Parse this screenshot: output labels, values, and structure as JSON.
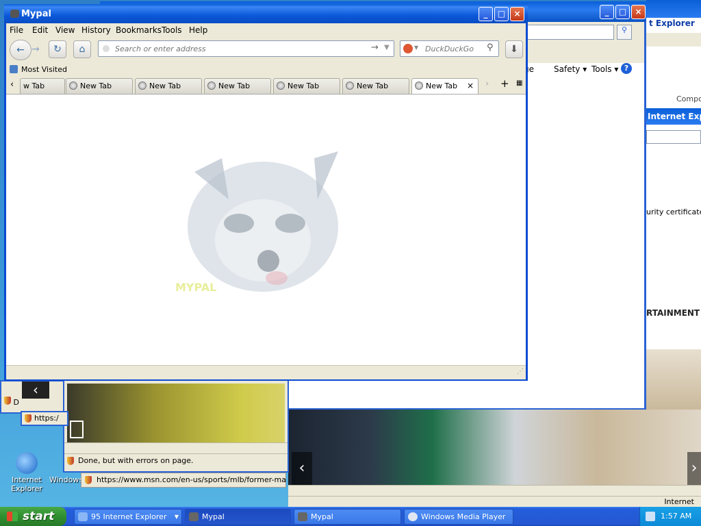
{
  "desktop": {
    "icons": [
      {
        "label": "Internet Explorer",
        "icon": "internet-explorer-icon"
      },
      {
        "label": "Windows Media Player",
        "icon": "media-player-icon"
      }
    ]
  },
  "ie_back": {
    "title": "t Explorer",
    "commands": [
      "ge",
      "Safety",
      "Tools"
    ],
    "help_icon": "help-icon"
  },
  "right_win": {
    "title": "Internet Explor",
    "label_compose": "Compos",
    "cert_text": "urity certificate o",
    "entertainment": "RTAINMENT",
    "status": "Internet"
  },
  "sports_win": {
    "url1": "https:/",
    "status": "Done, but with errors on page.",
    "url2": "https://www.msn.com/en-us/sports/mlb/former-major-le"
  },
  "small_win": {
    "status": "D"
  },
  "mypal": {
    "title": "Mypal",
    "menu": [
      "File",
      "Edit",
      "View",
      "History",
      "Bookmarks",
      "Tools",
      "Help"
    ],
    "address_placeholder": "Search or enter address",
    "search_engine": "DuckDuckGo",
    "bookmarks": {
      "most_visited": "Most Visited"
    },
    "tabs": [
      {
        "label": "w Tab",
        "active": false
      },
      {
        "label": "New Tab",
        "active": false
      },
      {
        "label": "New Tab",
        "active": false
      },
      {
        "label": "New Tab",
        "active": false
      },
      {
        "label": "New Tab",
        "active": false
      },
      {
        "label": "New Tab",
        "active": false
      },
      {
        "label": "New Tab",
        "active": true
      }
    ],
    "logo_text": "MYPAL"
  },
  "taskbar": {
    "start": "start",
    "items": [
      {
        "label": "95 Internet Explorer",
        "icon": "internet-explorer-icon"
      },
      {
        "label": "Mypal",
        "icon": "mypal-icon"
      },
      {
        "label": "Mypal",
        "icon": "mypal-icon"
      },
      {
        "label": "Windows Media Player",
        "icon": "media-player-icon"
      }
    ],
    "clock": "1:57 AM"
  },
  "colors": {
    "titlebar": "#0b58d8",
    "taskbar": "#245edb",
    "start": "#2f8f2f"
  }
}
